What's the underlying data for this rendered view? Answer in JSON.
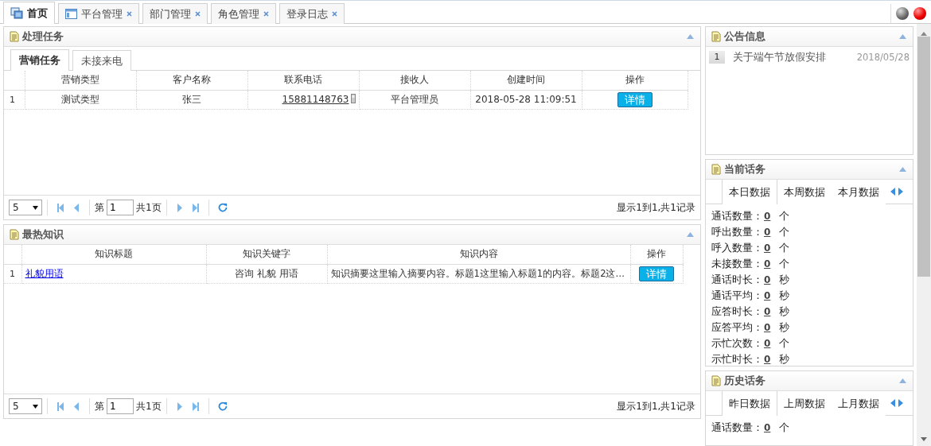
{
  "top_tabs": [
    {
      "label": "首页",
      "kind": "home",
      "closable": false,
      "selected": true
    },
    {
      "label": "平台管理",
      "kind": "module",
      "closable": true,
      "selected": false
    },
    {
      "label": "部门管理",
      "kind": "page",
      "closable": true,
      "selected": false
    },
    {
      "label": "角色管理",
      "kind": "page",
      "closable": true,
      "selected": false
    },
    {
      "label": "登录日志",
      "kind": "page",
      "closable": true,
      "selected": false
    }
  ],
  "tasks": {
    "title": "处理任务",
    "tabs": [
      {
        "label": "营销任务",
        "selected": true
      },
      {
        "label": "未接来电",
        "selected": false
      }
    ],
    "columns": [
      "营销类型",
      "客户名称",
      "联系电话",
      "接收人",
      "创建时间",
      "操作"
    ],
    "rows": [
      {
        "index": "1",
        "cells": [
          {
            "kind": "text",
            "text": "测试类型"
          },
          {
            "kind": "text",
            "text": "张三"
          },
          {
            "kind": "phone",
            "text": "15881148763"
          },
          {
            "kind": "text",
            "text": "平台管理员"
          },
          {
            "kind": "text",
            "text": "2018-05-28 11:09:51"
          },
          {
            "kind": "button",
            "text": "详情"
          }
        ]
      }
    ],
    "pager": {
      "page_size": "5",
      "page_prefix": "第",
      "page": "1",
      "page_total": "共1页",
      "summary": "显示1到1,共1记录"
    }
  },
  "knowledge": {
    "title": "最热知识",
    "columns": [
      "知识标题",
      "知识关键字",
      "知识内容",
      "操作"
    ],
    "rows": [
      {
        "index": "1",
        "cells": [
          {
            "kind": "link",
            "text": "礼貌用语"
          },
          {
            "kind": "text",
            "text": "咨询 礼貌 用语"
          },
          {
            "kind": "summary",
            "text": "知识摘要这里输入摘要内容。标题1这里输入标题1的内容。标题2这…"
          },
          {
            "kind": "button",
            "text": "详情"
          }
        ]
      }
    ],
    "pager": {
      "page_size": "5",
      "page_prefix": "第",
      "page": "1",
      "page_total": "共1页",
      "summary": "显示1到1,共1记录"
    }
  },
  "notices": {
    "title": "公告信息",
    "items": [
      {
        "index": "1",
        "title": "关于端午节放假安排",
        "date": "2018/05/28"
      }
    ]
  },
  "current_calls": {
    "title": "当前话务",
    "tabs": [
      {
        "label": "本日数据",
        "selected": true
      },
      {
        "label": "本周数据",
        "selected": false
      },
      {
        "label": "本月数据",
        "selected": false
      }
    ],
    "stats": [
      {
        "label": "通话数量：",
        "value": "0",
        "unit": "个"
      },
      {
        "label": "呼出数量：",
        "value": "0",
        "unit": "个"
      },
      {
        "label": "呼入数量：",
        "value": "0",
        "unit": "个"
      },
      {
        "label": "未接数量：",
        "value": "0",
        "unit": "个"
      },
      {
        "label": "通话时长：",
        "value": "0",
        "unit": "秒"
      },
      {
        "label": "通话平均：",
        "value": "0",
        "unit": "秒"
      },
      {
        "label": "应答时长：",
        "value": "0",
        "unit": "秒"
      },
      {
        "label": "应答平均：",
        "value": "0",
        "unit": "秒"
      },
      {
        "label": "示忙次数：",
        "value": "0",
        "unit": "个"
      },
      {
        "label": "示忙时长：",
        "value": "0",
        "unit": "秒"
      }
    ]
  },
  "history_calls": {
    "title": "历史话务",
    "tabs": [
      {
        "label": "昨日数据",
        "selected": true
      },
      {
        "label": "上周数据",
        "selected": false
      },
      {
        "label": "上月数据",
        "selected": false
      }
    ],
    "stats": [
      {
        "label": "通话数量：",
        "value": "0",
        "unit": "个"
      }
    ]
  }
}
